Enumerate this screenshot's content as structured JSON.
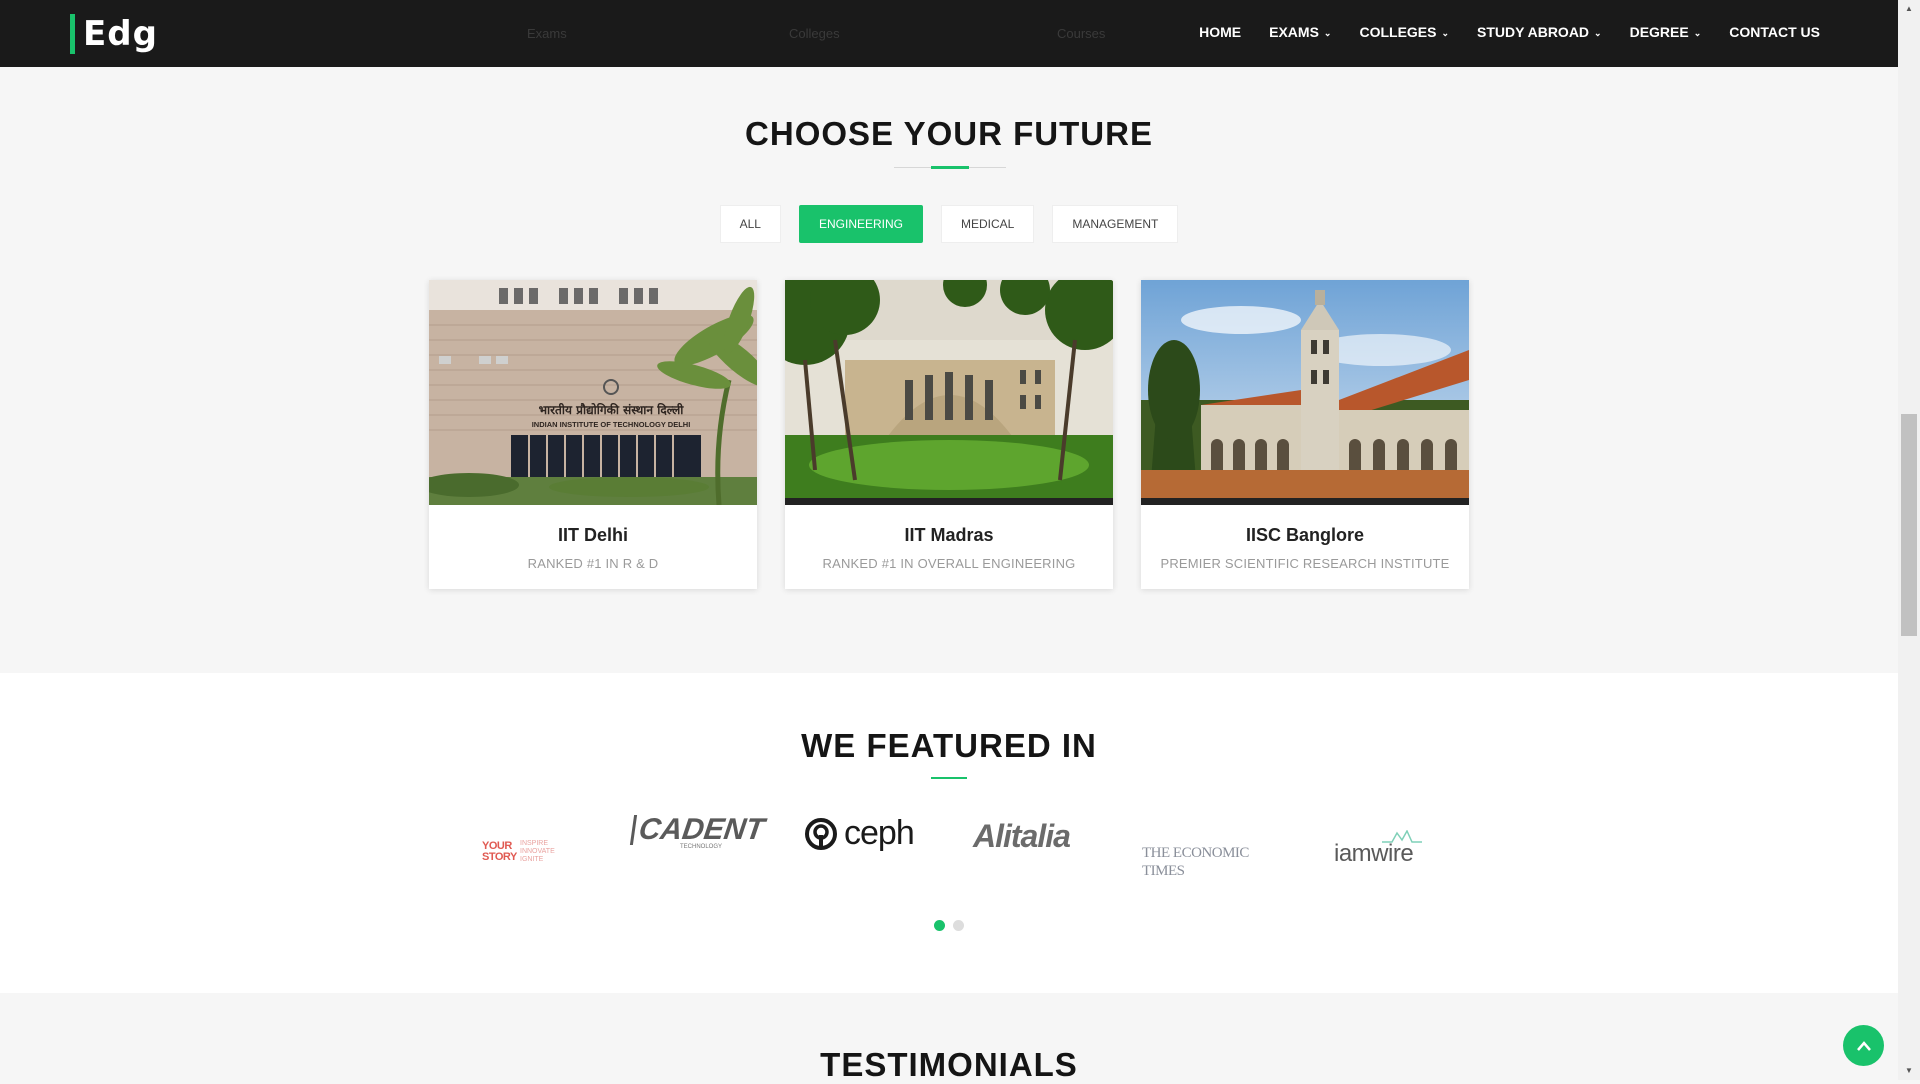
{
  "brand": {
    "logo_text": "Edg",
    "accent": "#19c26b"
  },
  "header": {
    "ghost_labels": [
      "Exams",
      "Colleges",
      "Courses"
    ],
    "nav": [
      {
        "label": "HOME",
        "dropdown": false
      },
      {
        "label": "EXAMS",
        "dropdown": true
      },
      {
        "label": "COLLEGES",
        "dropdown": true
      },
      {
        "label": "STUDY ABROAD",
        "dropdown": true
      },
      {
        "label": "DEGREE",
        "dropdown": true
      },
      {
        "label": "CONTACT US",
        "dropdown": false
      }
    ]
  },
  "choose_future": {
    "title": "CHOOSE YOUR FUTURE",
    "filters": [
      "ALL",
      "ENGINEERING",
      "MEDICAL",
      "MANAGEMENT"
    ],
    "active_filter": "ENGINEERING",
    "cards": [
      {
        "name": "IIT Delhi",
        "subtitle": "RANKED #1 IN R & D",
        "sign_hindi": "भारतीय प्रौद्योगिकी संस्थान दिल्ली",
        "sign_english": "INDIAN INSTITUTE OF TECHNOLOGY DELHI"
      },
      {
        "name": "IIT Madras",
        "subtitle": "RANKED #1 IN OVERALL ENGINEERING"
      },
      {
        "name": "IISC Banglore",
        "subtitle": "PREMIER SCIENTIFIC RESEARCH INSTITUTE"
      }
    ]
  },
  "featured": {
    "title": "WE FEATURED IN",
    "logos": [
      {
        "name": "yourstory-logo",
        "text": "YOUR STORY",
        "tagline": "INSPIRE INNOVATE IGNITE"
      },
      {
        "name": "cadent-logo",
        "text": "CADENT",
        "tagline": "TECHNOLOGY"
      },
      {
        "name": "ceph-logo",
        "text": "ceph"
      },
      {
        "name": "alitalia-logo",
        "text": "Alitalia"
      },
      {
        "name": "economic-times-logo",
        "text": "THE ECONOMIC TIMES"
      },
      {
        "name": "iamwire-logo",
        "text": "iamwire"
      }
    ],
    "pages": 2,
    "active_page": 1
  },
  "testimonials": {
    "title": "TESTIMONIALS"
  }
}
